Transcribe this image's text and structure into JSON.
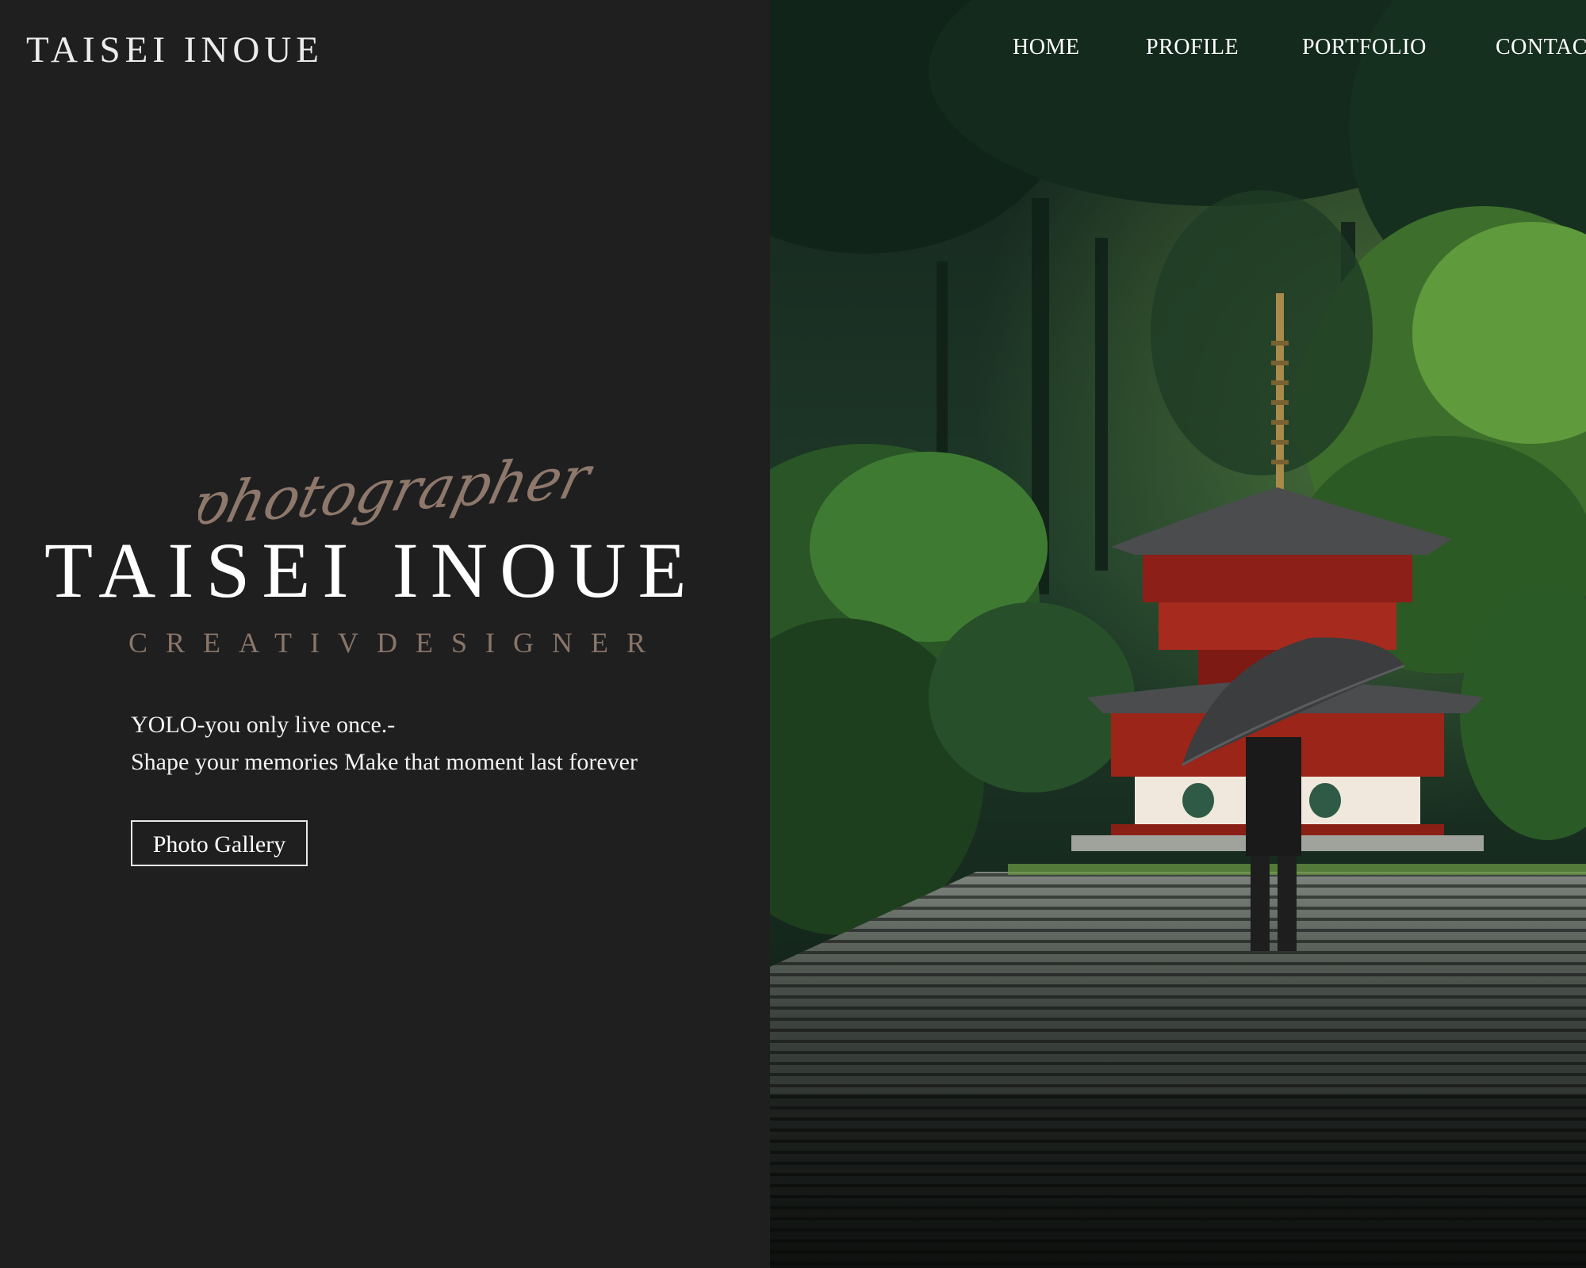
{
  "header": {
    "logo": "TAISEI INOUE"
  },
  "nav": {
    "items": [
      "HOME",
      "PROFILE",
      "PORTFOLIO",
      "CONTAC"
    ]
  },
  "hero": {
    "script_text": "photographer",
    "title": "TAISEI INOUE",
    "subtitle": "CREATIVDESIGNER",
    "tagline_line1": "YOLO-you only live once.-",
    "tagline_line2": "Shape your memories Make that moment last forever",
    "button_label": "Photo Gallery"
  },
  "colors": {
    "panel_bg": "#1f1f20",
    "accent": "#8a7668",
    "script_color": "#8e786b"
  }
}
